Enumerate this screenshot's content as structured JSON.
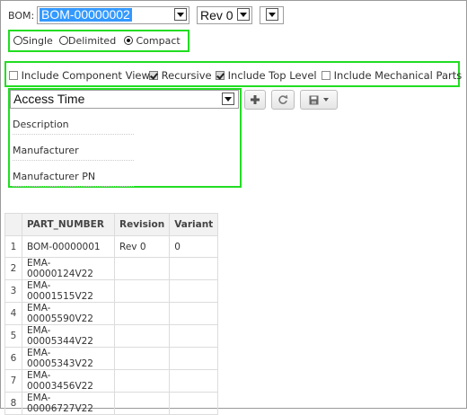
{
  "bom": {
    "label": "BOM:",
    "selected": "BOM-00000002",
    "revision": "Rev 0"
  },
  "modes": {
    "options": [
      "Single",
      "Delimited",
      "Compact"
    ],
    "selected": "Compact"
  },
  "checks": {
    "component_view": "Include Component View",
    "recursive": "Recursive",
    "top_level": "Include Top Level",
    "mechanical": "Include Mechanical Parts"
  },
  "attributes": {
    "selected": "Access Time",
    "items": [
      "Description",
      "Manufacturer",
      "Manufacturer PN"
    ]
  },
  "table": {
    "headers": [
      "PART_NUMBER",
      "Revision",
      "Variant"
    ],
    "rows": [
      {
        "n": "1",
        "part": "BOM-00000001",
        "rev": "Rev 0",
        "variant": "0"
      },
      {
        "n": "2",
        "part": "EMA-00000124V22",
        "rev": "",
        "variant": ""
      },
      {
        "n": "3",
        "part": "EMA-00001515V22",
        "rev": "",
        "variant": ""
      },
      {
        "n": "4",
        "part": "EMA-00005590V22",
        "rev": "",
        "variant": ""
      },
      {
        "n": "5",
        "part": "EMA-00005344V22",
        "rev": "",
        "variant": ""
      },
      {
        "n": "6",
        "part": "EMA-00005343V22",
        "rev": "",
        "variant": ""
      },
      {
        "n": "7",
        "part": "EMA-00003456V22",
        "rev": "",
        "variant": ""
      },
      {
        "n": "8",
        "part": "EMA-00006727V22",
        "rev": "",
        "variant": ""
      }
    ]
  },
  "colors": {
    "highlight": "#22dd22",
    "selection": "#3399ff"
  }
}
